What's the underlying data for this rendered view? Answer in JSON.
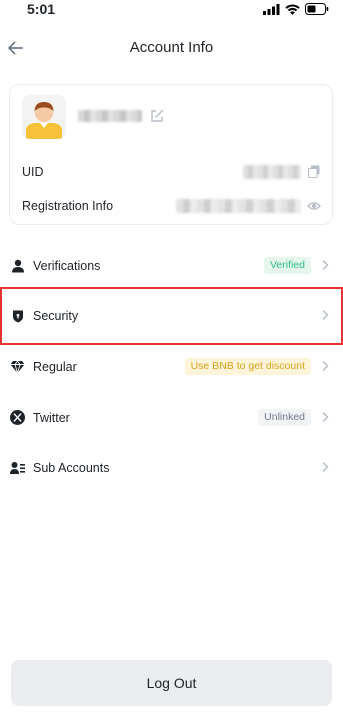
{
  "status_bar": {
    "time": "5:01"
  },
  "header": {
    "title": "Account Info"
  },
  "profile": {
    "uid_label": "UID",
    "registration_label": "Registration Info"
  },
  "menu": [
    {
      "id": "verifications",
      "label": "Verifications",
      "badge": "Verified",
      "badge_color": "#2ebd85"
    },
    {
      "id": "security",
      "label": "Security",
      "badge": ""
    },
    {
      "id": "regular",
      "label": "Regular",
      "badge": "Use BNB to get discount",
      "badge_color": "#d9a31a"
    },
    {
      "id": "twitter",
      "label": "Twitter",
      "badge": "Unlinked",
      "badge_color": "#707a8a"
    },
    {
      "id": "sub-accounts",
      "label": "Sub Accounts",
      "badge": ""
    }
  ],
  "footer": {
    "logout_label": "Log Out"
  },
  "colors": {
    "highlight": "#e3342f",
    "text": "#1e2329",
    "muted": "#707a8a"
  }
}
